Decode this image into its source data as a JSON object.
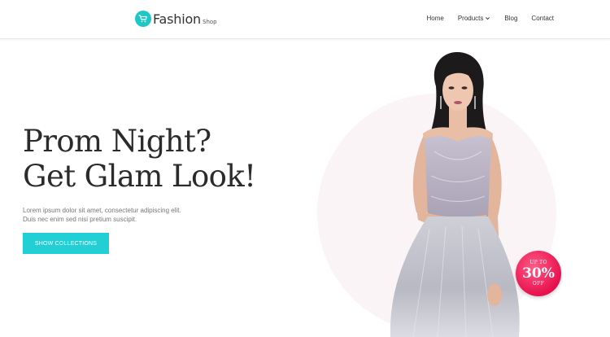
{
  "header": {
    "logo": {
      "brand": "Fashion",
      "sub": "Shop",
      "icon": "shopping-cart-icon"
    },
    "nav": [
      {
        "label": "Home"
      },
      {
        "label": "Products",
        "icon": "chevron-down-icon"
      },
      {
        "label": "Blog"
      },
      {
        "label": "Contact"
      }
    ]
  },
  "hero": {
    "headline_line1": "Prom Night?",
    "headline_line2": "Get Glam Look!",
    "description_line1": "Lorem ipsum dolor sit amet, consectetur adipiscing elit.",
    "description_line2": "Duis nec enim sed nisi pretium suscipit.",
    "cta_label": "SHOW COLLECTIONS"
  },
  "badge": {
    "top": "UP TO",
    "value": "30%",
    "bottom": "OFF"
  },
  "colors": {
    "accent": "#22cfd4",
    "badge": "#e8114d",
    "headline": "#2b2b2b"
  }
}
